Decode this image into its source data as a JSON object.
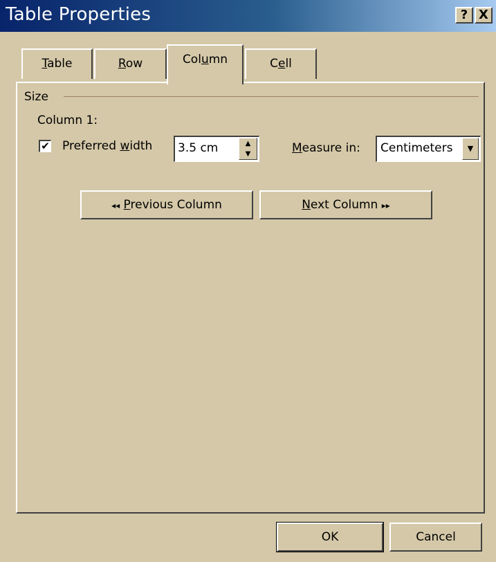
{
  "window": {
    "title": "Table Properties",
    "help_label": "?",
    "close_label": "X"
  },
  "tabs": [
    {
      "label": "Table",
      "mnemonic_index": 0,
      "active": false
    },
    {
      "label": "Row",
      "mnemonic_index": 0,
      "active": false
    },
    {
      "label": "Column",
      "mnemonic_index": 3,
      "active": true
    },
    {
      "label": "Cell",
      "mnemonic_index": 1,
      "active": false
    }
  ],
  "size_group": {
    "label": "Size",
    "column_label": "Column 1:",
    "preferred_width": {
      "checked": true,
      "label_before": "Preferred ",
      "label_mnemonic": "w",
      "label_after": "idth",
      "value": "3.5 cm"
    },
    "measure_in": {
      "label_mnemonic": "M",
      "label_after": "easure in:",
      "selected": "Centimeters"
    }
  },
  "navigation": {
    "previous": {
      "arrows": "◂◂",
      "mnemonic": "P",
      "rest": "revious Column"
    },
    "next": {
      "mnemonic": "N",
      "rest": "ext Column",
      "arrows": "▸▸"
    }
  },
  "footer": {
    "ok_label": "OK",
    "cancel_label": "Cancel"
  }
}
